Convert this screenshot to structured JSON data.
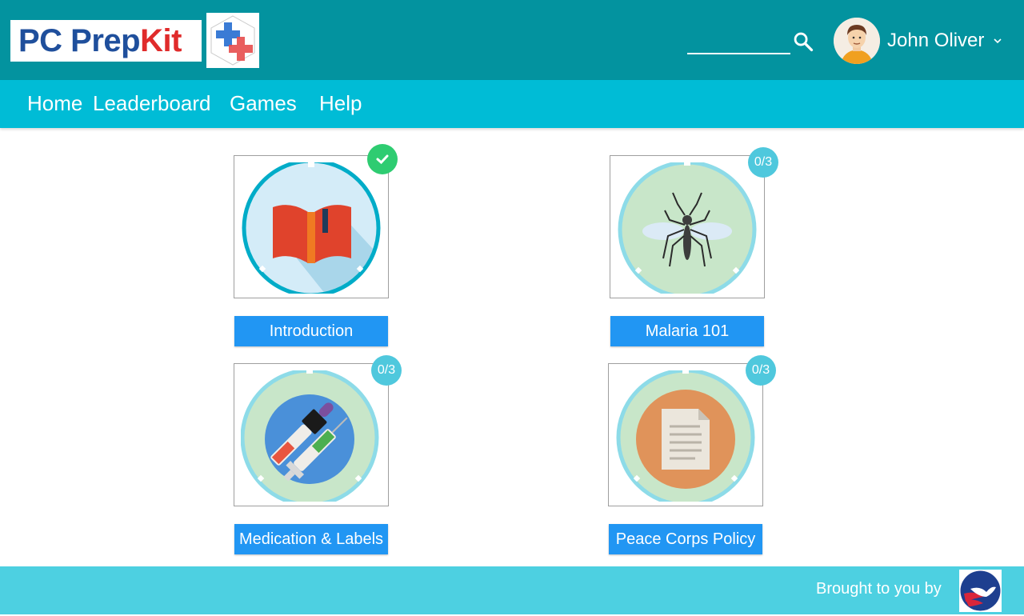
{
  "header": {
    "logo_text_pc": "PC Prep",
    "logo_text_kit": "Kit",
    "search": {
      "placeholder": "",
      "value": ""
    },
    "user": {
      "name": "John Oliver"
    }
  },
  "nav": {
    "items": [
      {
        "label": "Home"
      },
      {
        "label": "Leaderboard"
      },
      {
        "label": "Games"
      },
      {
        "label": "Help"
      }
    ]
  },
  "modules": [
    {
      "title": "Introduction",
      "status": "completed",
      "progress": ""
    },
    {
      "title": "Malaria 101",
      "status": "in-progress",
      "progress": "0/3"
    },
    {
      "title": "Medication & Labels",
      "status": "in-progress",
      "progress": "0/3"
    },
    {
      "title": "Peace Corps Policy",
      "status": "in-progress",
      "progress": "0/3"
    }
  ],
  "footer": {
    "text": "Brought to you by"
  },
  "colors": {
    "header": "#03939f",
    "nav": "#00bcd6",
    "footer": "#4dd0e1",
    "button": "#2196f3",
    "badge": "#4fc8dd",
    "badge_done": "#2ecc71"
  }
}
